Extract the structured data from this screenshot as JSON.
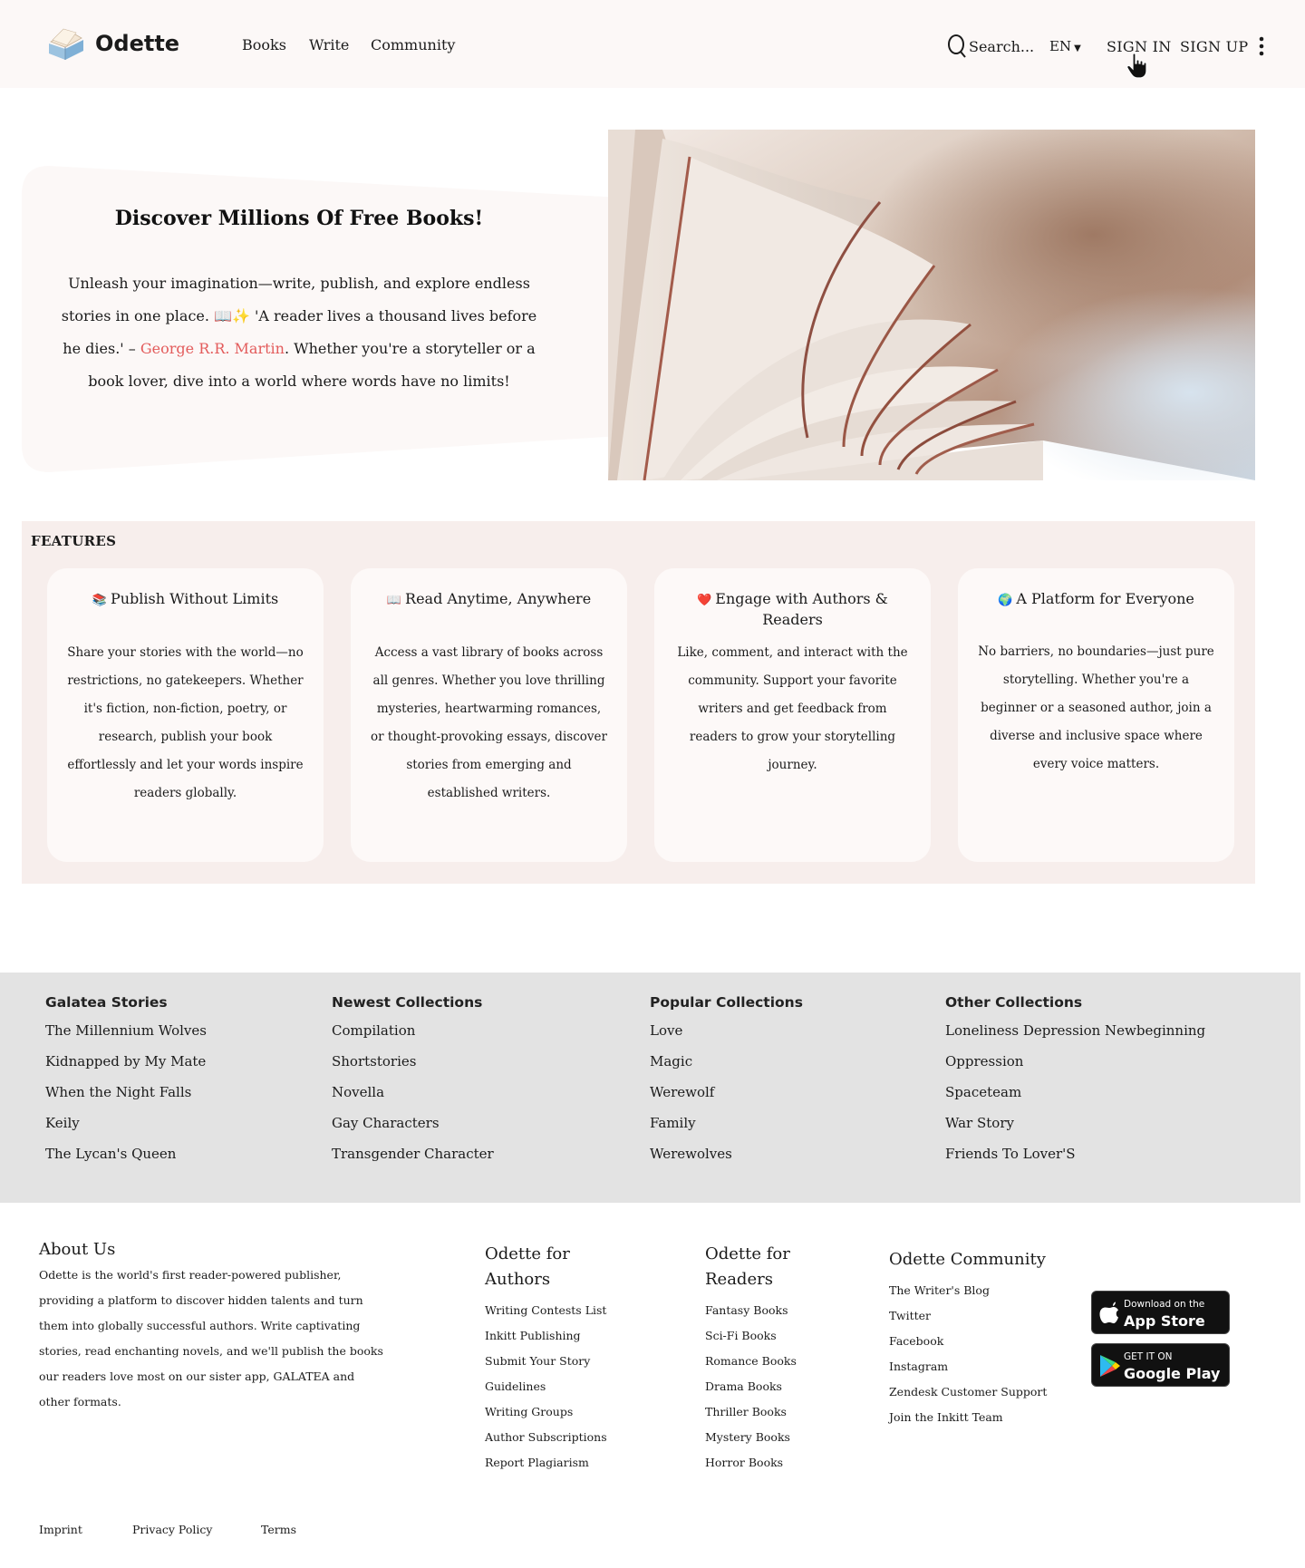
{
  "header": {
    "brand": "Odette",
    "nav": [
      "Books",
      "Write",
      "Community"
    ],
    "search_placeholder": "Search...",
    "language": "EN",
    "sign_in": "SIGN IN",
    "sign_up": "SIGN UP"
  },
  "hero": {
    "title": "Discover Millions Of Free Books!",
    "text_1": "Unleash your imagination—write, publish, and explore endless stories in one place. 📖✨ 'A reader lives a thousand lives before he dies.' –",
    "author": "George R.R. Martin",
    "text_2": ". Whether you're a storyteller or a book lover, dive into a world where words have no limits!"
  },
  "features": {
    "title": "FEATURES",
    "cards": [
      {
        "emoji": "📚",
        "title": "Publish Without Limits",
        "body": "Share your stories with the world—no restrictions, no gatekeepers. Whether it's fiction, non-fiction, poetry, or research, publish your book effortlessly and let your words inspire readers globally."
      },
      {
        "emoji": "📖",
        "title": "Read Anytime, Anywhere",
        "body": "Access a vast library of books across all genres. Whether you love thrilling mysteries, heartwarming romances, or thought-provoking essays, discover stories from emerging and established writers."
      },
      {
        "emoji": "❤️",
        "title": "Engage with Authors & Readers",
        "body": "Like, comment, and interact with the community. Support your favorite writers and get feedback from readers to grow your storytelling journey."
      },
      {
        "emoji": "🌍",
        "title": "A Platform for Everyone",
        "body": "No barriers, no boundaries—just pure storytelling. Whether you're a beginner or a seasoned author, join a diverse and inclusive space where every voice matters."
      }
    ]
  },
  "collections": [
    {
      "title": "Galatea Stories",
      "items": [
        "The Millennium Wolves",
        "Kidnapped by My Mate",
        "When the Night Falls",
        "Keily",
        "The Lycan's Queen"
      ]
    },
    {
      "title": "Newest Collections",
      "items": [
        "Compilation",
        "Shortstories",
        "Novella",
        "Gay Characters",
        "Transgender Character"
      ]
    },
    {
      "title": "Popular Collections",
      "items": [
        "Love",
        "Magic",
        "Werewolf",
        "Family",
        "Werewolves"
      ]
    },
    {
      "title": "Other Collections",
      "items": [
        "Loneliness Depression Newbeginning",
        "Oppression",
        "Spaceteam",
        "War Story",
        "Friends To Lover'S"
      ]
    }
  ],
  "footer": {
    "about_title": "About Us",
    "about_text": "Odette is the world's first reader-powered publisher, providing a platform to discover hidden talents and turn them into globally successful authors. Write captivating stories, read enchanting novels, and we'll publish the books our readers love most on our sister app, GALATEA and other formats.",
    "authors_title": "Odette for Authors",
    "authors_links": [
      "Writing Contests List",
      "Inkitt Publishing",
      "Submit Your Story",
      "Guidelines",
      "Writing Groups",
      "Author Subscriptions",
      "Report Plagiarism"
    ],
    "readers_title": "Odette for Readers",
    "readers_links": [
      "Fantasy Books",
      "Sci-Fi Books",
      "Romance Books",
      "Drama Books",
      "Thriller Books",
      "Mystery Books",
      "Horror Books"
    ],
    "community_title": "Odette Community",
    "community_links": [
      "The Writer's Blog",
      "Twitter",
      "Facebook",
      "Instagram",
      "Zendesk Customer Support",
      "Join the Inkitt Team"
    ],
    "app_store_small": "Download on the",
    "app_store_big": "App Store",
    "google_play_small": "GET IT ON",
    "google_play_big": "Google Play",
    "legal": [
      "Imprint",
      "Privacy Policy",
      "Terms"
    ]
  }
}
